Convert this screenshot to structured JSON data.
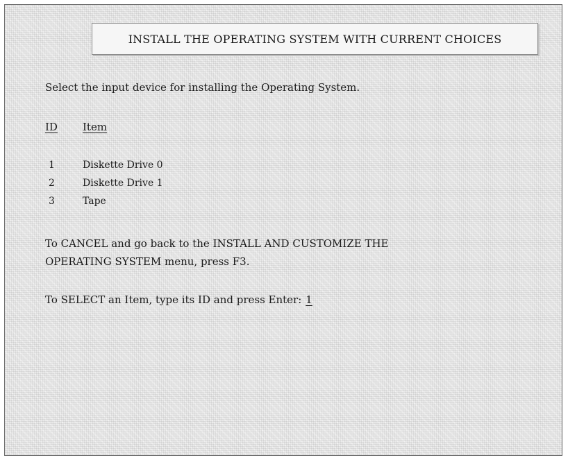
{
  "screen": {
    "title": "INSTALL THE OPERATING SYSTEM WITH CURRENT CHOICES",
    "instruction": "Select the input device for installing the Operating System.",
    "table": {
      "headers": {
        "id": "ID",
        "item": "Item"
      },
      "rows": [
        {
          "id": "1",
          "label": "Diskette Drive 0"
        },
        {
          "id": "2",
          "label": "Diskette Drive 1"
        },
        {
          "id": "3",
          "label": "Tape"
        }
      ]
    },
    "cancel_line_1": "To CANCEL and go back to the INSTALL AND CUSTOMIZE THE",
    "cancel_line_2": "OPERATING SYSTEM menu, press F3.",
    "select_prompt": "To SELECT an Item, type its ID and press Enter:",
    "selected_value": "1"
  }
}
